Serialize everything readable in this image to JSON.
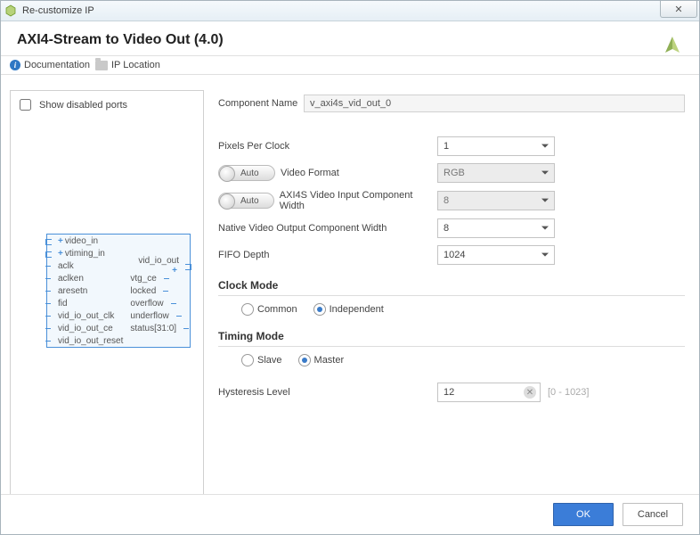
{
  "window": {
    "title": "Re-customize IP",
    "close_glyph": "✕"
  },
  "header": {
    "title": "AXI4-Stream to Video Out (4.0)"
  },
  "toolbar": {
    "documentation": "Documentation",
    "ip_location": "IP Location"
  },
  "left": {
    "show_disabled_label": "Show disabled ports",
    "ports_in": [
      "video_in",
      "vtiming_in",
      "aclk",
      "aclken",
      "aresetn",
      "fid",
      "vid_io_out_clk",
      "vid_io_out_ce",
      "vid_io_out_reset"
    ],
    "ports_in_bus": [
      true,
      true,
      false,
      false,
      false,
      false,
      false,
      false,
      false
    ],
    "ports_out": [
      "vid_io_out",
      "vtg_ce",
      "locked",
      "overflow",
      "underflow",
      "status[31:0]"
    ],
    "ports_out_bus": [
      true,
      false,
      false,
      false,
      false,
      false
    ]
  },
  "form": {
    "component_name_label": "Component Name",
    "component_name": "v_axi4s_vid_out_0",
    "pixels_per_clock_label": "Pixels Per Clock",
    "pixels_per_clock": "1",
    "auto_label": "Auto",
    "video_format_label": "Video Format",
    "video_format": "RGB",
    "axi4s_width_label": "AXI4S Video Input Component Width",
    "axi4s_width": "8",
    "native_width_label": "Native Video Output Component Width",
    "native_width": "8",
    "fifo_depth_label": "FIFO Depth",
    "fifo_depth": "1024",
    "clock_mode_title": "Clock Mode",
    "clock_mode_common": "Common",
    "clock_mode_independent": "Independent",
    "timing_mode_title": "Timing Mode",
    "timing_mode_slave": "Slave",
    "timing_mode_master": "Master",
    "hysteresis_label": "Hysteresis Level",
    "hysteresis_value": "12",
    "hysteresis_hint": "[0 - 1023]"
  },
  "footer": {
    "ok": "OK",
    "cancel": "Cancel"
  }
}
